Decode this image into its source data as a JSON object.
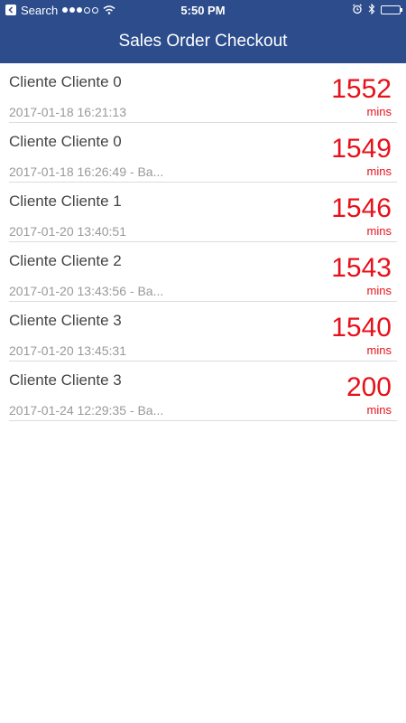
{
  "status_bar": {
    "back_label": "Search",
    "time": "5:50 PM",
    "icons": [
      "signal-icon",
      "wifi-icon",
      "alarm-icon",
      "bluetooth-icon",
      "battery-icon"
    ]
  },
  "nav": {
    "title": "Sales Order Checkout"
  },
  "orders": [
    {
      "client": "Cliente Cliente 0",
      "timestamp": "2017-01-18 16:21:13",
      "value": "1552",
      "unit": "mins"
    },
    {
      "client": "Cliente Cliente 0",
      "timestamp": "2017-01-18 16:26:49 - Ba...",
      "value": "1549",
      "unit": "mins"
    },
    {
      "client": "Cliente Cliente 1",
      "timestamp": "2017-01-20 13:40:51",
      "value": "1546",
      "unit": "mins"
    },
    {
      "client": "Cliente Cliente 2",
      "timestamp": "2017-01-20 13:43:56 - Ba...",
      "value": "1543",
      "unit": "mins"
    },
    {
      "client": "Cliente Cliente 3",
      "timestamp": "2017-01-20 13:45:31",
      "value": "1540",
      "unit": "mins"
    },
    {
      "client": "Cliente Cliente 3",
      "timestamp": "2017-01-24 12:29:35 - Ba...",
      "value": "200",
      "unit": "mins"
    }
  ],
  "colors": {
    "header_bg": "#2c4c8c",
    "value_red": "#e8101a"
  }
}
